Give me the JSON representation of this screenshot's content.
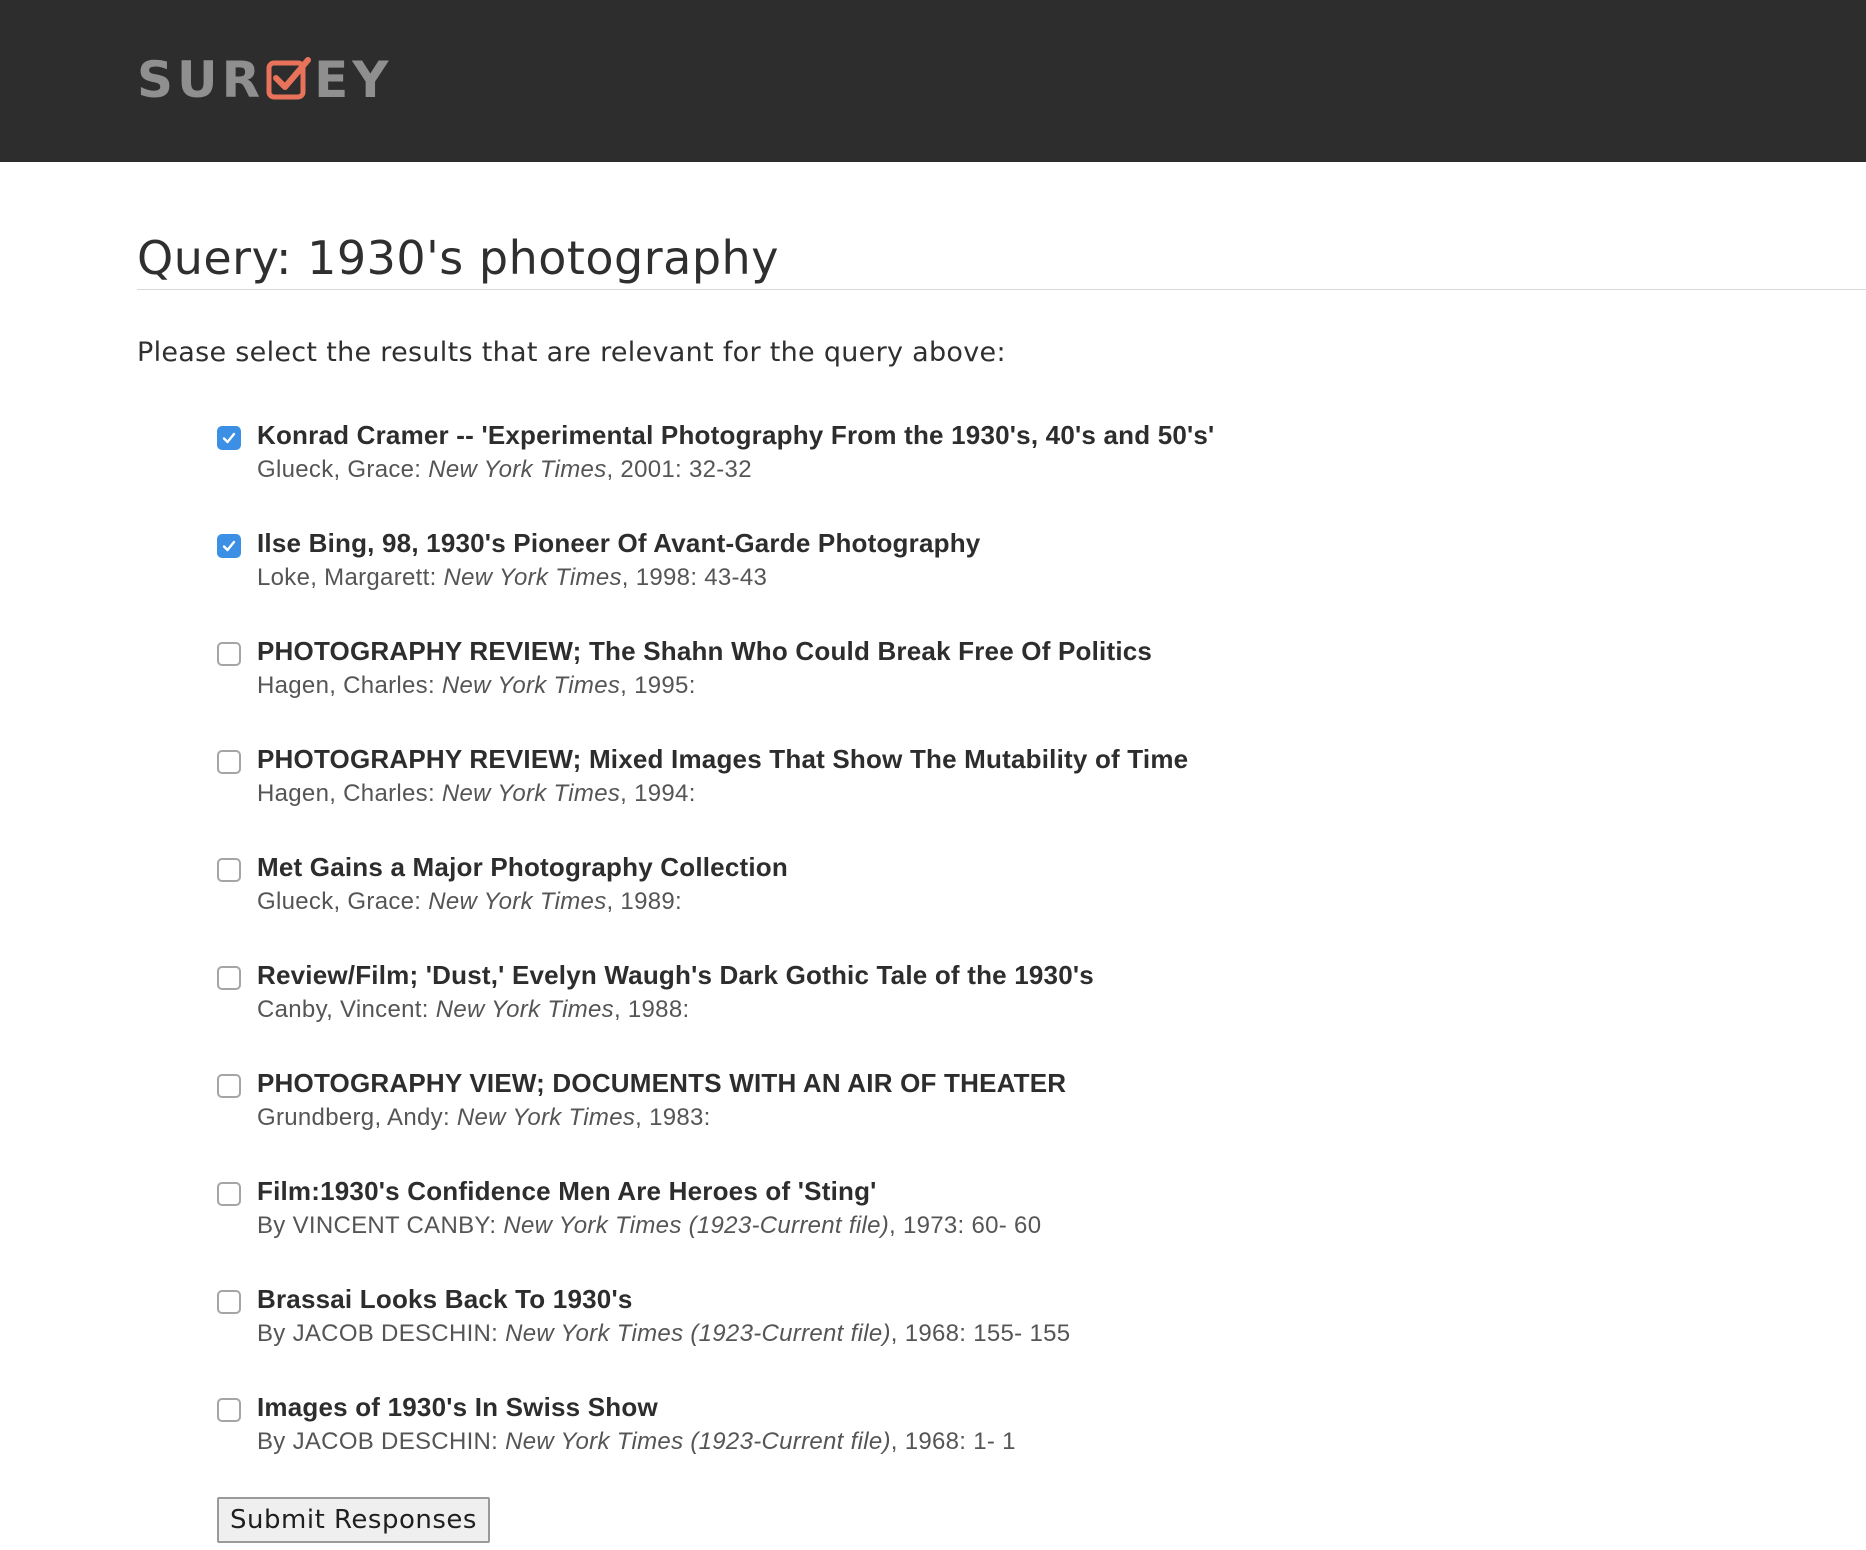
{
  "header": {
    "logo_prefix": "SUR",
    "logo_suffix": "EY",
    "logo_check_color": "#e8735a",
    "background_color": "#2d2d2d"
  },
  "main": {
    "query_label": "Query: 1930's photography",
    "instructions": "Please select the results that are relevant for the query above:"
  },
  "results": [
    {
      "checked": true,
      "title": "Konrad Cramer -- 'Experimental Photography From the 1930's, 40's and 50's'",
      "author": "Glueck, Grace:",
      "source": "New York Times",
      "details": ", 2001: 32-32"
    },
    {
      "checked": true,
      "title": "Ilse Bing, 98, 1930's Pioneer Of Avant-Garde Photography",
      "author": "Loke, Margarett:",
      "source": "New York Times",
      "details": ", 1998: 43-43"
    },
    {
      "checked": false,
      "title": "PHOTOGRAPHY REVIEW; The Shahn Who Could Break Free Of Politics",
      "author": "Hagen, Charles:",
      "source": "New York Times",
      "details": ", 1995:"
    },
    {
      "checked": false,
      "title": "PHOTOGRAPHY REVIEW; Mixed Images That Show The Mutability of Time",
      "author": "Hagen, Charles:",
      "source": "New York Times",
      "details": ", 1994:"
    },
    {
      "checked": false,
      "title": "Met Gains a Major Photography Collection",
      "author": "Glueck, Grace:",
      "source": "New York Times",
      "details": ", 1989:"
    },
    {
      "checked": false,
      "title": "Review/Film; 'Dust,' Evelyn Waugh's Dark Gothic Tale of the 1930's",
      "author": "Canby, Vincent:",
      "source": "New York Times",
      "details": ", 1988:"
    },
    {
      "checked": false,
      "title": "PHOTOGRAPHY VIEW; DOCUMENTS WITH AN AIR OF THEATER",
      "author": "Grundberg, Andy:",
      "source": "New York Times",
      "details": ", 1983:"
    },
    {
      "checked": false,
      "title": "Film:1930's Confidence Men Are Heroes of 'Sting'",
      "author": "By VINCENT CANBY:",
      "source": "New York Times (1923-Current file)",
      "details": ", 1973: 60- 60"
    },
    {
      "checked": false,
      "title": "Brassai Looks Back To 1930's",
      "author": "By JACOB DESCHIN:",
      "source": "New York Times (1923-Current file)",
      "details": ", 1968: 155- 155"
    },
    {
      "checked": false,
      "title": "Images of 1930's In Swiss Show",
      "author": "By JACOB DESCHIN:",
      "source": "New York Times (1923-Current file)",
      "details": ", 1968: 1- 1"
    }
  ],
  "submit": {
    "label": "Submit Responses"
  },
  "colors": {
    "checkbox_checked": "#3b8fe4",
    "text": "#2d2d2d",
    "meta_text": "#555555"
  }
}
